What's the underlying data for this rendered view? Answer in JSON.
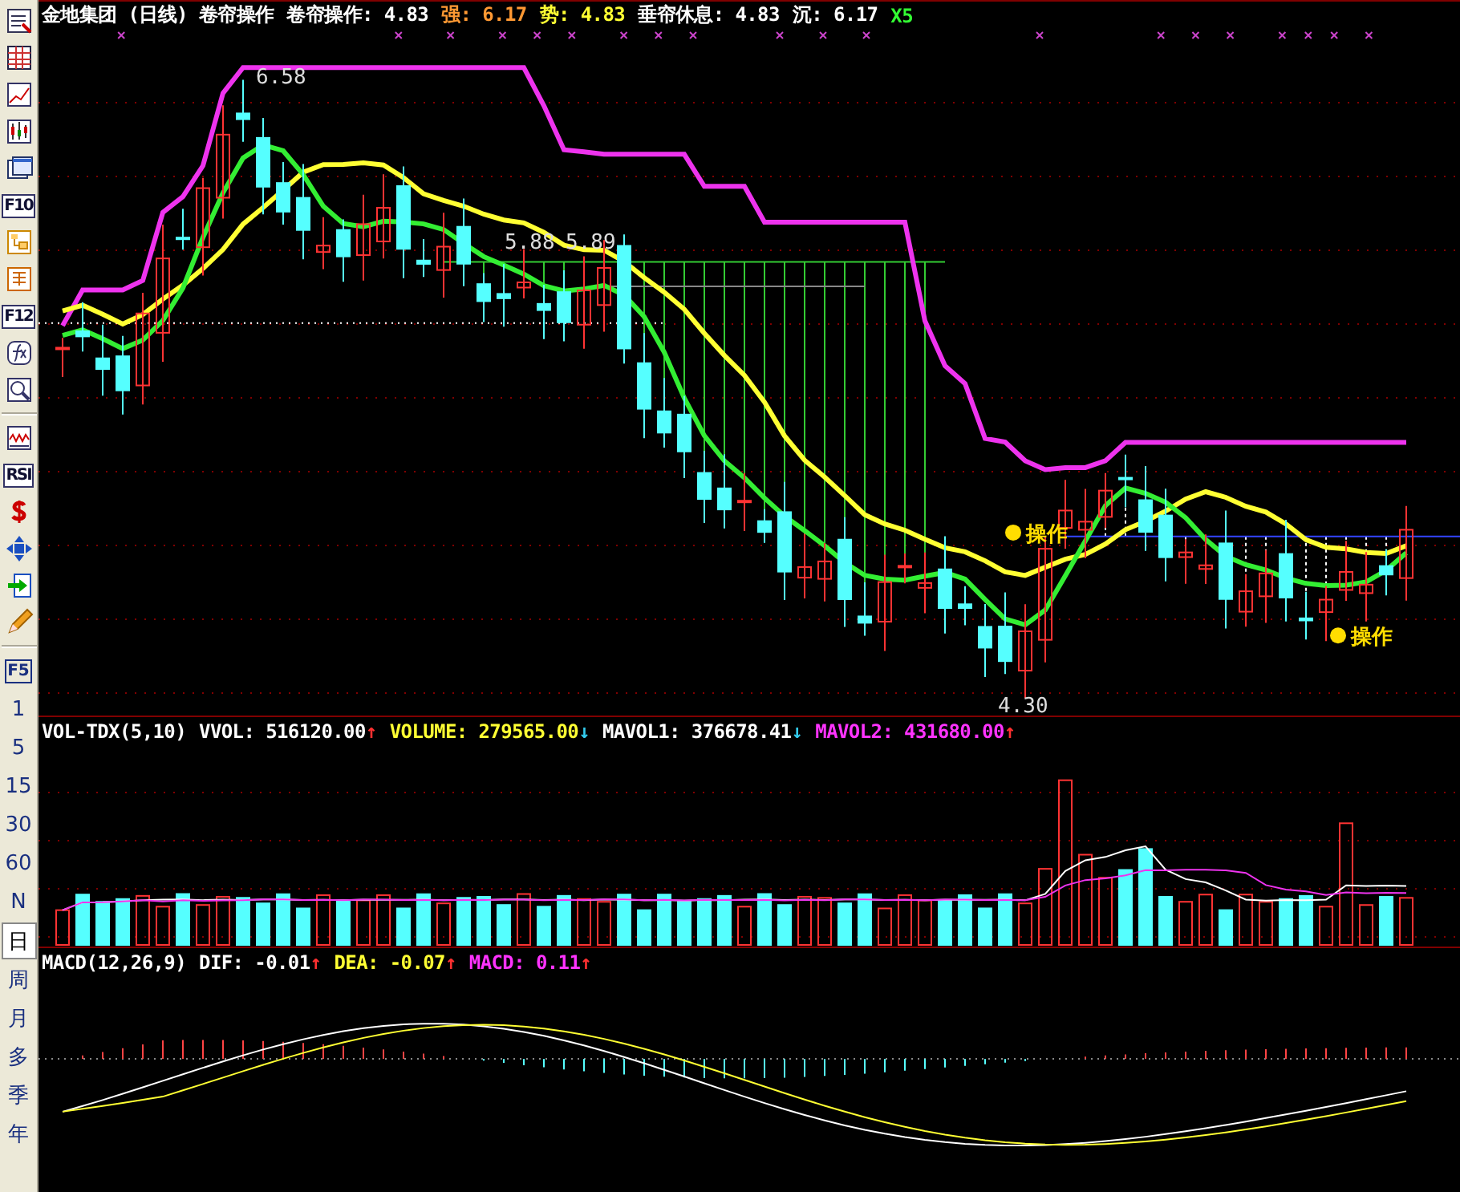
{
  "toolbar": {
    "tools": [
      {
        "kind": "report"
      },
      {
        "kind": "table"
      },
      {
        "kind": "trend"
      },
      {
        "kind": "candles"
      },
      {
        "kind": "windows"
      },
      {
        "kind": "label",
        "text": "F10"
      },
      {
        "kind": "tree"
      },
      {
        "kind": "doc"
      },
      {
        "kind": "label",
        "text": "F12"
      },
      {
        "kind": "formula"
      },
      {
        "kind": "zoom"
      },
      {
        "kind": "divider"
      },
      {
        "kind": "wave"
      },
      {
        "kind": "label",
        "text": "RSI"
      },
      {
        "kind": "dollar"
      },
      {
        "kind": "move"
      },
      {
        "kind": "exit"
      },
      {
        "kind": "pencil"
      },
      {
        "kind": "divider"
      }
    ],
    "periods": [
      {
        "kind": "key",
        "label": "F5",
        "selected": false
      },
      {
        "kind": "period",
        "label": "1",
        "selected": false
      },
      {
        "kind": "period",
        "label": "5",
        "selected": false
      },
      {
        "kind": "period",
        "label": "15",
        "selected": false
      },
      {
        "kind": "period",
        "label": "30",
        "selected": false
      },
      {
        "kind": "period",
        "label": "60",
        "selected": false
      },
      {
        "kind": "period",
        "label": "N",
        "selected": false
      },
      {
        "kind": "period",
        "label": "日",
        "selected": true
      },
      {
        "kind": "period",
        "label": "周",
        "selected": false
      },
      {
        "kind": "period",
        "label": "月",
        "selected": false
      },
      {
        "kind": "period",
        "label": "多",
        "selected": false
      },
      {
        "kind": "period",
        "label": "季",
        "selected": false
      },
      {
        "kind": "period",
        "label": "年",
        "selected": false
      }
    ]
  },
  "price_header": {
    "title": "金地集团 (日线) 卷帘操作",
    "items": [
      {
        "label": "卷帘操作:",
        "value": "4.83",
        "color": "#ffffff"
      },
      {
        "label": "强:",
        "value": "6.17",
        "color": "#ff9933"
      },
      {
        "label": "势:",
        "value": "4.83",
        "color": "#ffff33"
      },
      {
        "label": "垂帘休息:",
        "value": "4.83",
        "color": "#ffffff"
      },
      {
        "label": "沉:",
        "value": "6.17",
        "color": "#ffffff"
      },
      {
        "label": "X5",
        "value": "",
        "color": "#33ff33"
      }
    ]
  },
  "price_chart": {
    "labels": [
      "6.58",
      "5.88",
      "5.89",
      "4.30"
    ],
    "signals": [
      {
        "text": "操作"
      },
      {
        "text": "操作"
      }
    ]
  },
  "volume_header": {
    "title": "VOL-TDX(5,10)",
    "items": [
      {
        "label": "VVOL:",
        "value": "516120.00",
        "color": "#ffffff",
        "arrow": "↑",
        "rising": true
      },
      {
        "label": "VOLUME:",
        "value": "279565.00",
        "color": "#ffff33",
        "arrow": "↓",
        "rising": false
      },
      {
        "label": "MAVOL1:",
        "value": "376678.41",
        "color": "#ffffff",
        "arrow": "↓",
        "rising": false
      },
      {
        "label": "MAVOL2:",
        "value": "431680.00",
        "color": "#ff33ff",
        "arrow": "↑",
        "rising": true
      }
    ]
  },
  "macd_header": {
    "title": "MACD(12,26,9)",
    "items": [
      {
        "label": "DIF:",
        "value": "-0.01",
        "color": "#ffffff",
        "arrow": "↑",
        "rising": true
      },
      {
        "label": "DEA:",
        "value": "-0.07",
        "color": "#ffff33",
        "arrow": "↑",
        "rising": true
      },
      {
        "label": "MACD:",
        "value": "0.11",
        "color": "#ff33ff",
        "arrow": "↑",
        "rising": true
      }
    ]
  }
}
